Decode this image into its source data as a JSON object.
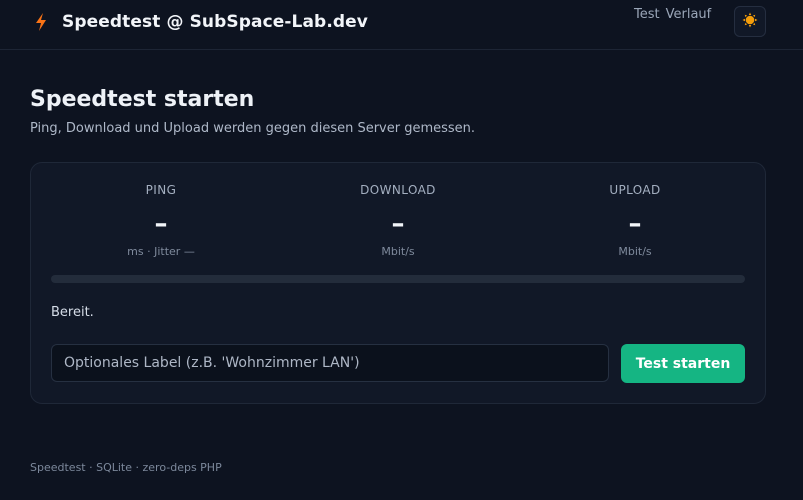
{
  "header": {
    "brand_icon": "lightning-bolt-icon",
    "brand_color": "#f97316",
    "title": "Speedtest @ SubSpace-Lab.dev",
    "nav": [
      {
        "label": "Test"
      },
      {
        "label": "Verlauf"
      }
    ],
    "theme_icon": "sun-icon"
  },
  "hero": {
    "title": "Speedtest starten",
    "subtitle": "Ping, Download und Upload werden gegen diesen Server gemessen."
  },
  "metrics": [
    {
      "label": "PING",
      "value": "–",
      "unit": "ms · Jitter —"
    },
    {
      "label": "DOWNLOAD",
      "value": "–",
      "unit": "Mbit/s"
    },
    {
      "label": "UPLOAD",
      "value": "–",
      "unit": "Mbit/s"
    }
  ],
  "progress": {
    "percent": 0
  },
  "status": "Bereit.",
  "label_input": {
    "value": "",
    "placeholder": "Optionales Label (z.B. 'Wohnzimmer LAN')"
  },
  "start_button": {
    "label": "Test starten"
  },
  "accent_color": "#15b583",
  "footer": "Speedtest · SQLite · zero-deps PHP"
}
